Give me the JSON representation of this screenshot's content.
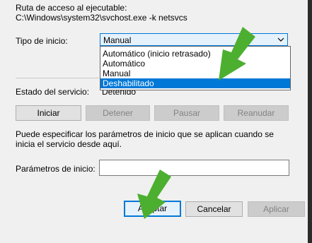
{
  "path": {
    "label": "Ruta de acceso al ejecutable:",
    "value": "C:\\Windows\\system32\\svchost.exe -k netsvcs"
  },
  "startup": {
    "label": "Tipo de inicio:",
    "selected": "Manual",
    "options": [
      "Automático (inicio retrasado)",
      "Automático",
      "Manual",
      "Deshabilitado"
    ],
    "highlighted_option": "Deshabilitado"
  },
  "status": {
    "label": "Estado del servicio:",
    "value": "Detenido"
  },
  "service_buttons": {
    "start": "Iniciar",
    "stop": "Detener",
    "pause": "Pausar",
    "resume": "Reanudar"
  },
  "params": {
    "description": "Puede especificar los parámetros de inicio que se aplican cuando se inicia el servicio desde aquí.",
    "label": "Parámetros de inicio:",
    "value": ""
  },
  "dialog_buttons": {
    "ok": "Aceptar",
    "cancel": "Cancelar",
    "apply": "Aplicar"
  },
  "colors": {
    "accent": "#0078d7",
    "annotation_arrow": "#4caf30"
  },
  "icons": {
    "dropdown": "chevron-down-icon",
    "annotation": "green-arrow-icon"
  }
}
